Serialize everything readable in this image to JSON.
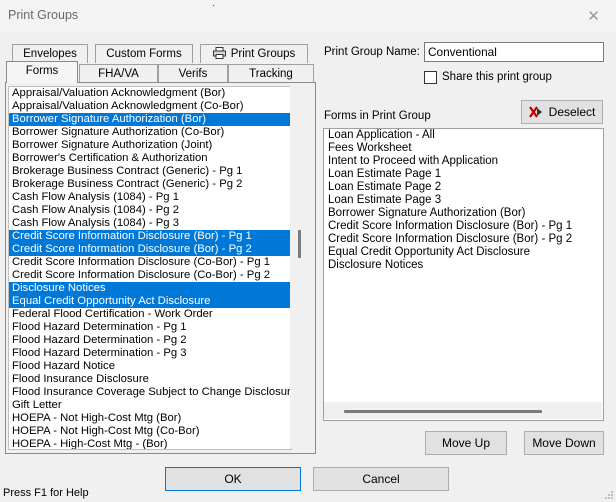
{
  "window": {
    "title": "Print Groups",
    "close_glyph": "✕",
    "top_mark": "·"
  },
  "tabs": {
    "row_back": [
      "Envelopes",
      "Custom Forms",
      "Print Groups"
    ],
    "row_front": [
      "Forms",
      "FHA/VA",
      "Verifs",
      "Tracking"
    ],
    "active": "Forms"
  },
  "available_forms": [
    {
      "label": "Appraisal/Valuation  Acknowledgment (Bor)",
      "selected": false
    },
    {
      "label": "Appraisal/Valuation  Acknowledgment (Co-Bor)",
      "selected": false
    },
    {
      "label": "Borrower Signature Authorization (Bor)",
      "selected": true
    },
    {
      "label": "Borrower Signature Authorization (Co-Bor)",
      "selected": false
    },
    {
      "label": "Borrower Signature Authorization (Joint)",
      "selected": false
    },
    {
      "label": "Borrower's Certification & Authorization",
      "selected": false
    },
    {
      "label": "Brokerage Business Contract (Generic) - Pg 1",
      "selected": false
    },
    {
      "label": "Brokerage Business Contract (Generic) - Pg 2",
      "selected": false
    },
    {
      "label": "Cash Flow Analysis (1084) - Pg 1",
      "selected": false
    },
    {
      "label": "Cash Flow Analysis (1084) - Pg 2",
      "selected": false
    },
    {
      "label": "Cash Flow Analysis (1084) - Pg 3",
      "selected": false
    },
    {
      "label": "Credit Score Information Disclosure (Bor) - Pg 1",
      "selected": true
    },
    {
      "label": "Credit Score Information Disclosure (Bor) - Pg 2",
      "selected": true
    },
    {
      "label": "Credit Score Information Disclosure (Co-Bor) - Pg 1",
      "selected": false
    },
    {
      "label": "Credit Score Information Disclosure (Co-Bor) - Pg 2",
      "selected": false
    },
    {
      "label": "Disclosure Notices",
      "selected": true
    },
    {
      "label": "Equal Credit Opportunity Act Disclosure",
      "selected": true
    },
    {
      "label": "Federal Flood Certification - Work Order",
      "selected": false
    },
    {
      "label": "Flood Hazard Determination - Pg 1",
      "selected": false
    },
    {
      "label": "Flood Hazard Determination - Pg 2",
      "selected": false
    },
    {
      "label": "Flood Hazard Determination - Pg 3",
      "selected": false
    },
    {
      "label": "Flood Hazard Notice",
      "selected": false
    },
    {
      "label": "Flood Insurance Disclosure",
      "selected": false
    },
    {
      "label": "Flood Insurance Coverage Subject to Change Disclosure",
      "selected": false
    },
    {
      "label": "Gift Letter",
      "selected": false
    },
    {
      "label": "HOEPA - Not High-Cost Mtg (Bor)",
      "selected": false
    },
    {
      "label": "HOEPA - Not High-Cost Mtg (Co-Bor)",
      "selected": false
    },
    {
      "label": "HOEPA - High-Cost Mtg - (Bor)",
      "selected": false
    }
  ],
  "print_group": {
    "name_label": "Print Group Name:",
    "name_value": "Conventional",
    "share_label": "Share this print group",
    "share_checked": false,
    "forms_label": "Forms in Print Group",
    "deselect_label": "Deselect",
    "forms": [
      "Loan Application - All",
      "Fees Worksheet",
      "Intent to Proceed with Application",
      "Loan Estimate Page 1",
      "Loan Estimate Page 2",
      "Loan Estimate Page 3",
      "Borrower Signature Authorization (Bor)",
      "Credit Score Information Disclosure (Bor) - Pg 1",
      "Credit Score Information Disclosure (Bor) - Pg 2",
      "Equal Credit Opportunity Act Disclosure",
      "Disclosure Notices"
    ],
    "move_up_label": "Move Up",
    "move_down_label": "Move Down"
  },
  "footer": {
    "ok_label": "OK",
    "cancel_label": "Cancel",
    "status_text": "Press F1 for Help"
  },
  "colors": {
    "selection": "#0078d7",
    "background": "#f0f0f0",
    "deselect_icon": "#c00000"
  }
}
